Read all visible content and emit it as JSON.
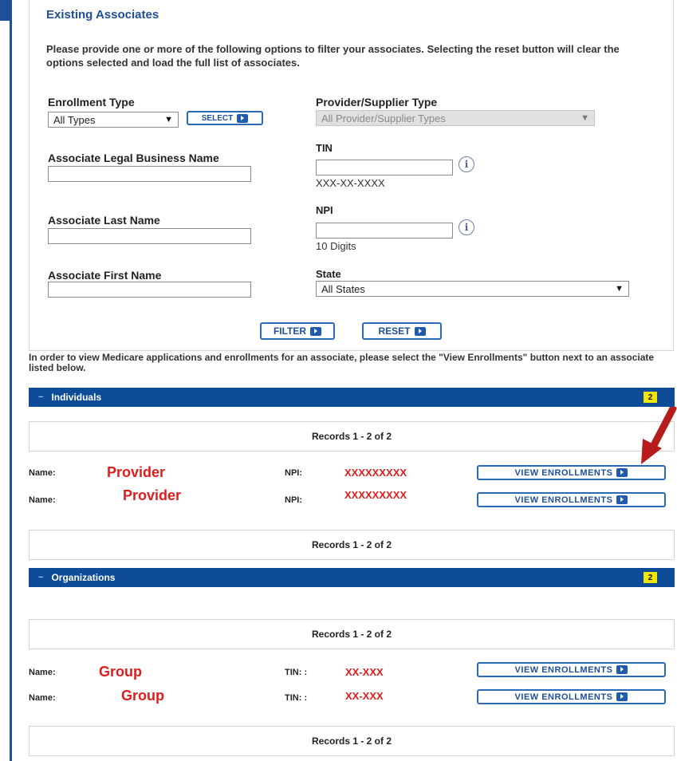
{
  "filters": {
    "title": "Existing Associates",
    "intro": "Please provide one or more of the following options to filter your associates. Selecting the reset button will clear the options selected and load the full list of associates.",
    "enrollment_type": {
      "label": "Enrollment Type",
      "value": "All Types",
      "select_button": "SELECT"
    },
    "provider_type": {
      "label": "Provider/Supplier Type",
      "value": "All Provider/Supplier Types"
    },
    "legal_name": {
      "label": "Associate Legal Business Name",
      "value": ""
    },
    "tin": {
      "label": "TIN",
      "value": "",
      "hint": "XXX-XX-XXXX"
    },
    "last_name": {
      "label": "Associate Last Name",
      "value": ""
    },
    "npi": {
      "label": "NPI",
      "value": "",
      "hint": "10 Digits"
    },
    "first_name": {
      "label": "Associate First Name",
      "value": ""
    },
    "state": {
      "label": "State",
      "value": "All States"
    },
    "filter_button": "FILTER",
    "reset_button": "RESET"
  },
  "note": "In order to view Medicare applications and enrollments for an associate, please select the \"View Enrollments\" button next to an associate listed below.",
  "individuals": {
    "title": "Individuals",
    "count": "2",
    "records_top": "Records 1 - 2 of 2",
    "records_bottom": "Records 1 - 2 of 2",
    "rows": [
      {
        "name_label": "Name:",
        "name": "Provider",
        "id_label": "NPI:",
        "id": "XXXXXXXXX",
        "button": "VIEW ENROLLMENTS"
      },
      {
        "name_label": "Name:",
        "name": "Provider",
        "id_label": "NPI:",
        "id": "XXXXXXXXX",
        "button": "VIEW ENROLLMENTS"
      }
    ]
  },
  "organizations": {
    "title": "Organizations",
    "count": "2",
    "records_top": "Records 1 - 2 of 2",
    "records_bottom": "Records 1 - 2 of 2",
    "rows": [
      {
        "name_label": "Name:",
        "name": "Group",
        "id_label": "TIN: :",
        "id": "XX-XXX",
        "button": "VIEW ENROLLMENTS"
      },
      {
        "name_label": "Name:",
        "name": "Group",
        "id_label": "TIN: :",
        "id": "XX-XXX",
        "button": "VIEW ENROLLMENTS"
      }
    ]
  },
  "colors": {
    "header_blue": "#0e4c97",
    "count_badge": "#f2e600",
    "annotation_red": "#e01c1c",
    "annotation_arrow": "#b71c1c"
  },
  "icons": [
    "info-icon",
    "chevron-down-icon",
    "arrow-right-icon",
    "collapse-icon",
    "annotation-arrow-icon"
  ]
}
